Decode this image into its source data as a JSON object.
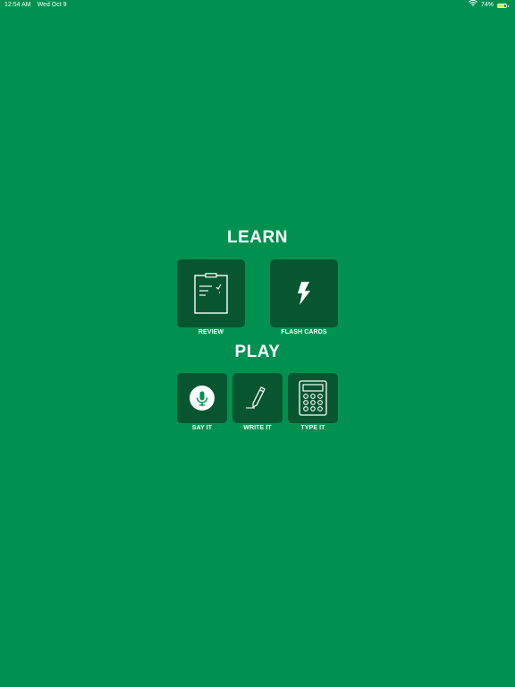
{
  "status_bar": {
    "time": "12:54 AM",
    "date": "Wed Oct 9",
    "battery_percent": "74%",
    "battery_level": 0.74
  },
  "learn": {
    "title": "LEARN",
    "items": [
      {
        "label": "REVIEW",
        "icon": "clipboard-icon"
      },
      {
        "label": "FLASH CARDS",
        "icon": "lightning-bolt-icon"
      }
    ]
  },
  "play": {
    "title": "PLAY",
    "items": [
      {
        "label": "SAY IT",
        "icon": "microphone-icon"
      },
      {
        "label": "WRITE IT",
        "icon": "pencil-icon"
      },
      {
        "label": "TYPE IT",
        "icon": "calculator-icon"
      }
    ]
  },
  "colors": {
    "background": "#009150",
    "tile": "#075630",
    "text": "#ffffff"
  }
}
